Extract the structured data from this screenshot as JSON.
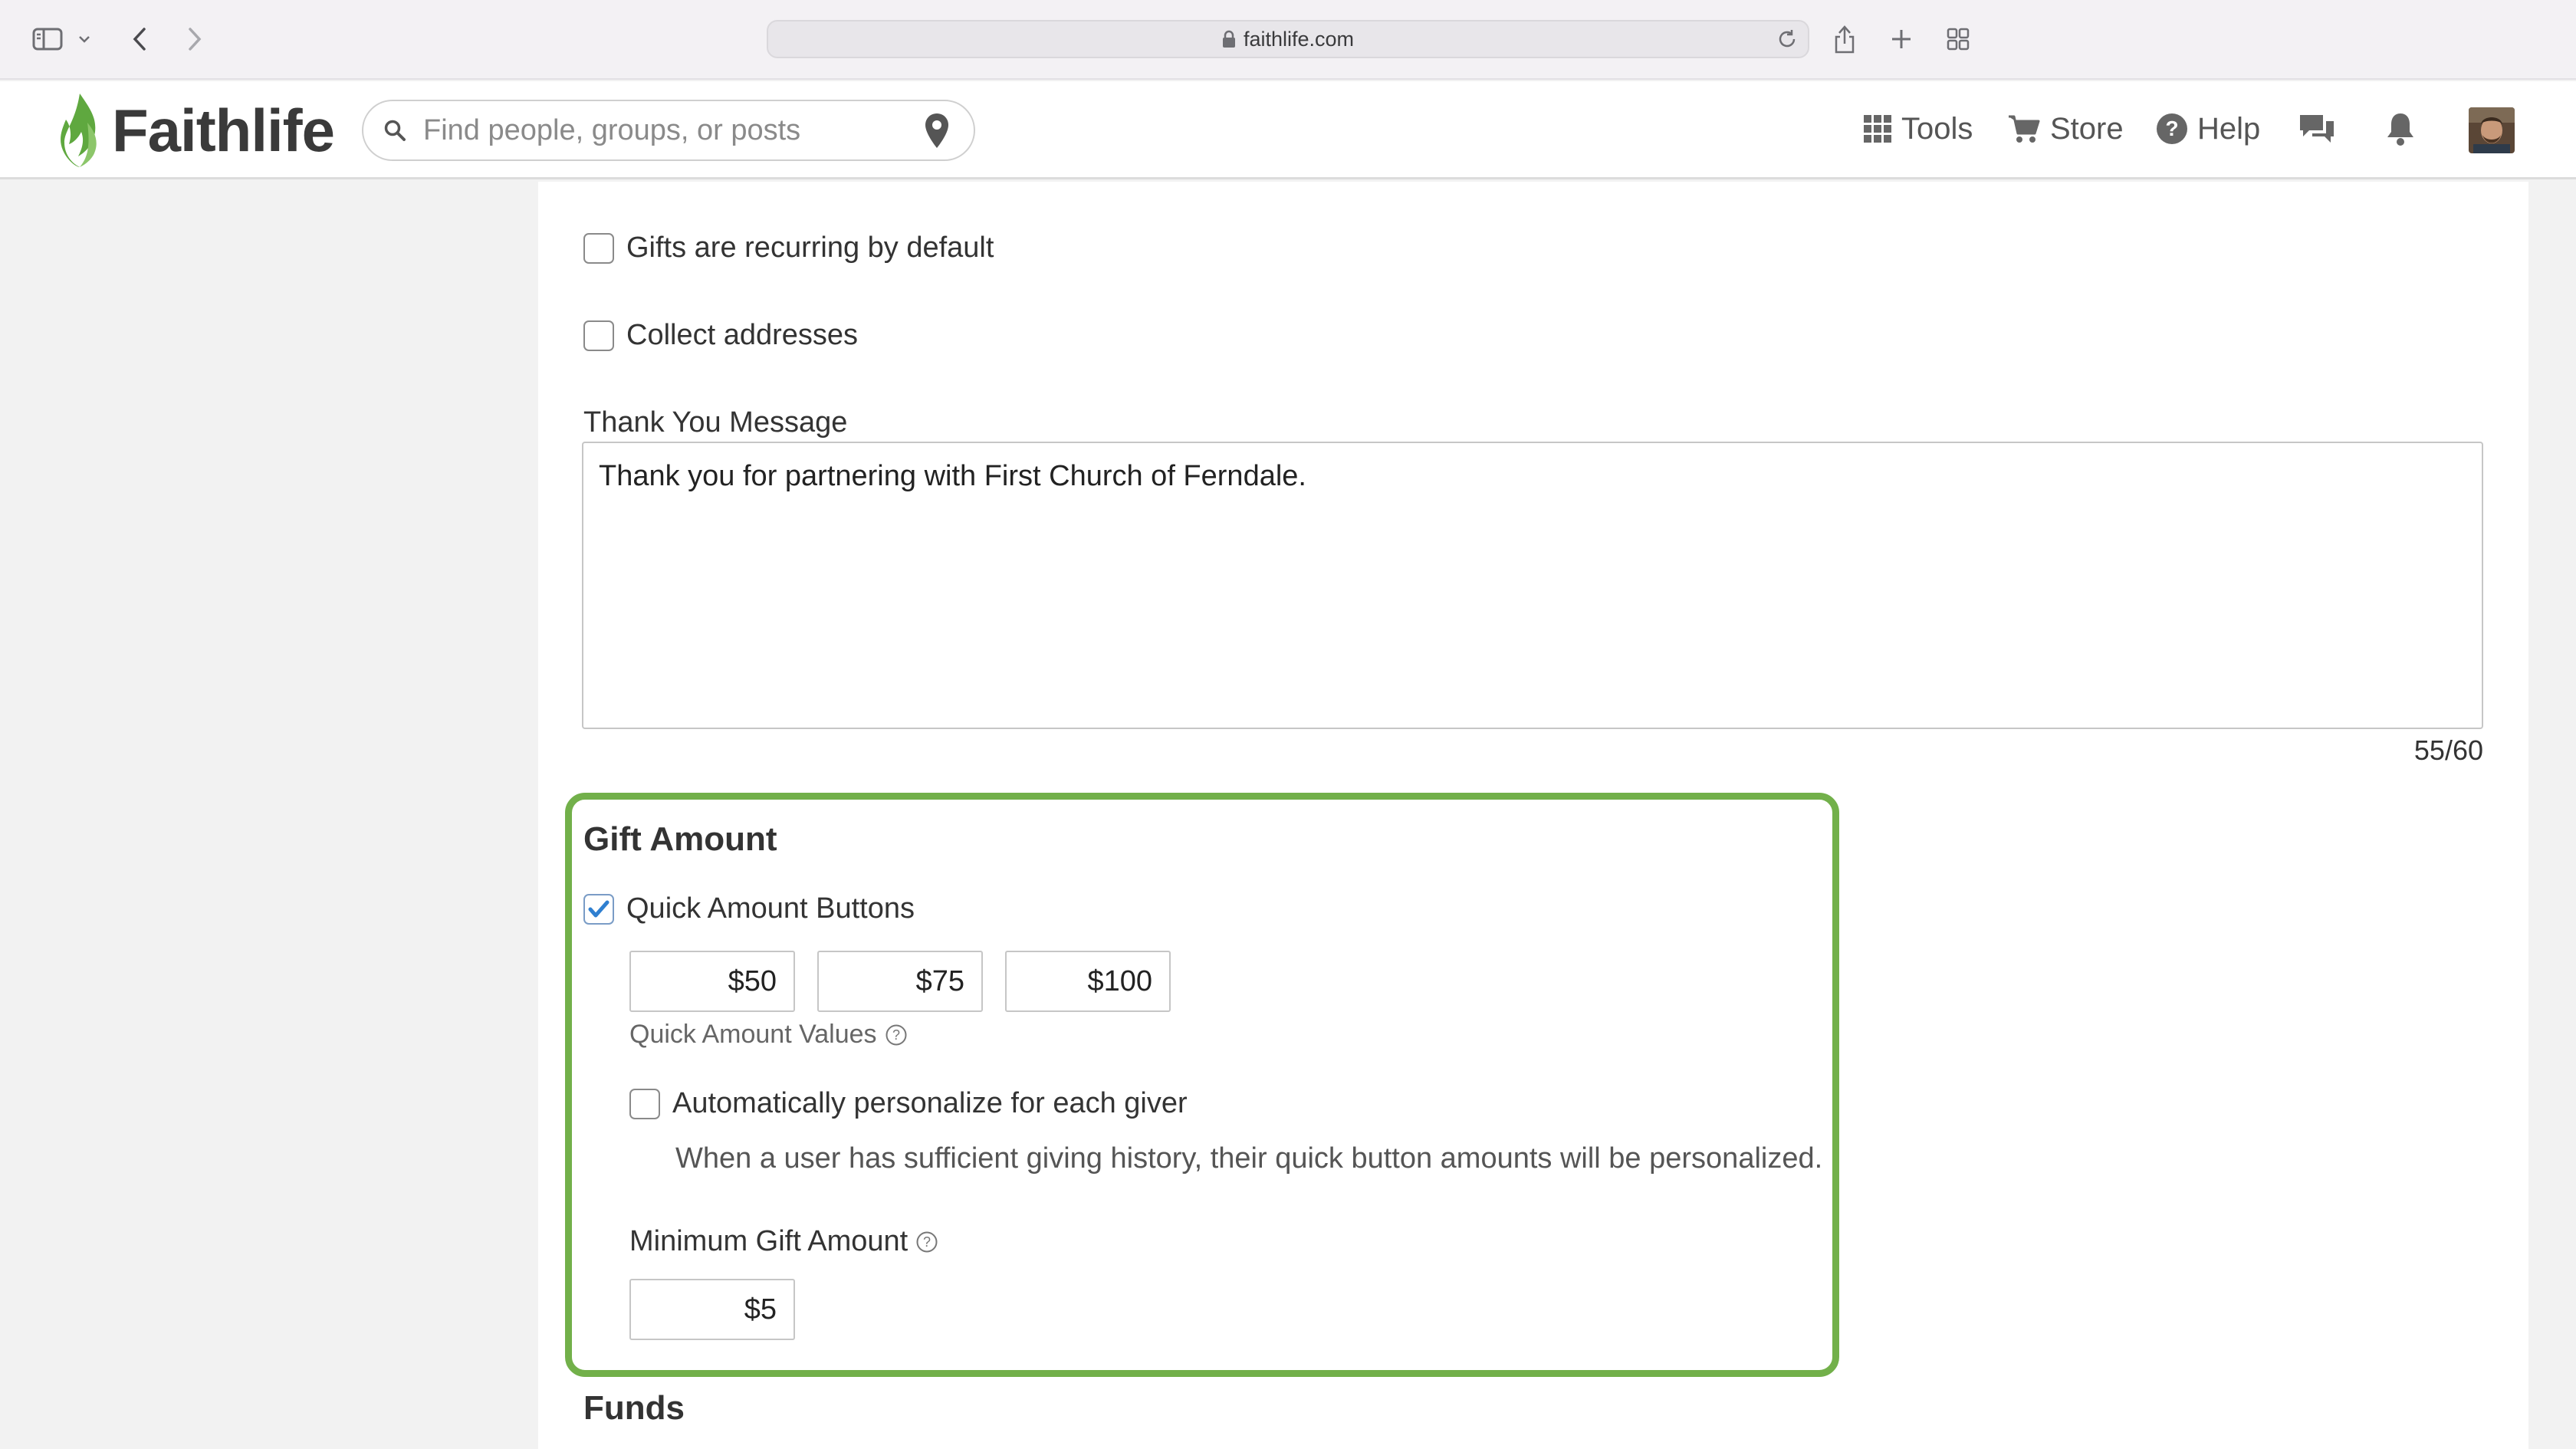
{
  "browser": {
    "url": "faithlife.com"
  },
  "header": {
    "logo_text": "Faithlife",
    "search_placeholder": "Find people, groups, or posts",
    "nav": {
      "tools": "Tools",
      "store": "Store",
      "help": "Help"
    },
    "brand_color": "#5fa83f"
  },
  "form": {
    "gifts_recurring_label": "Gifts are recurring by default",
    "gifts_recurring_checked": false,
    "collect_addresses_label": "Collect addresses",
    "collect_addresses_checked": false,
    "thank_you_label": "Thank You Message",
    "thank_you_value": "Thank you for partnering with First Church of Ferndale.",
    "thank_you_counter": "55/60"
  },
  "gift_amount": {
    "title": "Gift Amount",
    "highlight_color": "#72b04a",
    "quick_buttons_label": "Quick Amount Buttons",
    "quick_buttons_checked": true,
    "quick_values": [
      "$50",
      "$75",
      "$100"
    ],
    "quick_values_label": "Quick Amount Values",
    "personalize_label": "Automatically personalize for each giver",
    "personalize_checked": false,
    "personalize_desc": "When a user has sufficient giving history, their quick button amounts will be personalized.",
    "minimum_label": "Minimum Gift Amount",
    "minimum_value": "$5"
  },
  "funds": {
    "title": "Funds"
  }
}
